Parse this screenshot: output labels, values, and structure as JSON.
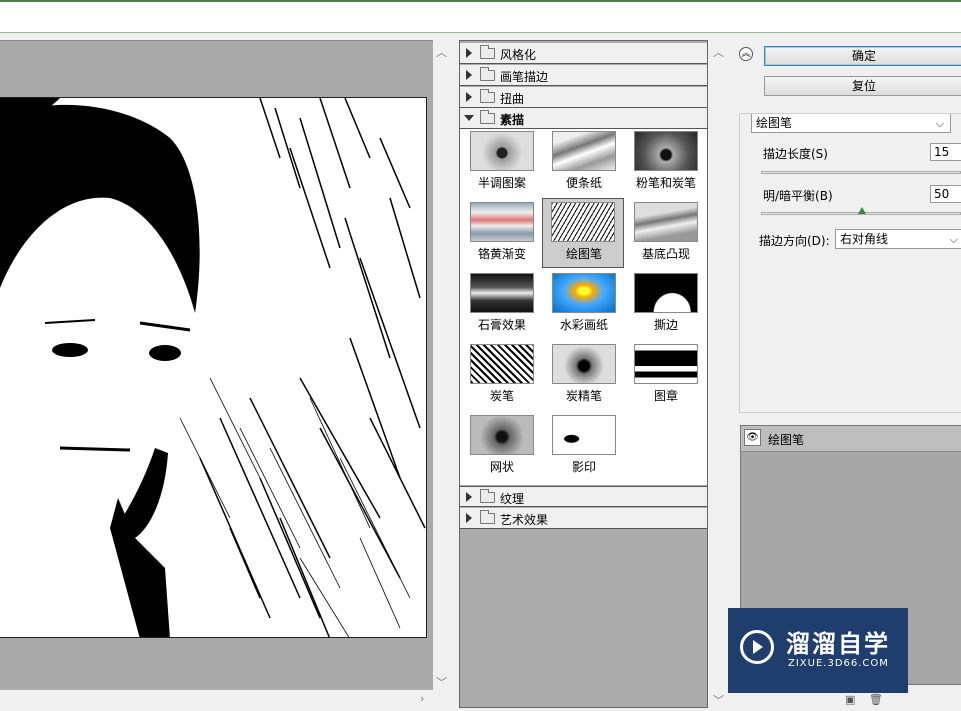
{
  "filter_categories_top": [
    {
      "label": "风格化",
      "expanded": false
    },
    {
      "label": "画笔描边",
      "expanded": false
    },
    {
      "label": "扭曲",
      "expanded": false
    },
    {
      "label": "素描",
      "expanded": true
    }
  ],
  "sketch_filters": [
    {
      "label": "半调图案",
      "selected": false
    },
    {
      "label": "便条纸",
      "selected": false
    },
    {
      "label": "粉笔和炭笔",
      "selected": false
    },
    {
      "label": "铬黄渐变",
      "selected": false
    },
    {
      "label": "绘图笔",
      "selected": true
    },
    {
      "label": "基底凸现",
      "selected": false
    },
    {
      "label": "石膏效果",
      "selected": false
    },
    {
      "label": "水彩画纸",
      "selected": false
    },
    {
      "label": "撕边",
      "selected": false
    },
    {
      "label": "炭笔",
      "selected": false
    },
    {
      "label": "炭精笔",
      "selected": false
    },
    {
      "label": "图章",
      "selected": false
    },
    {
      "label": "网状",
      "selected": false
    },
    {
      "label": "影印",
      "selected": false
    }
  ],
  "filter_categories_bottom": [
    {
      "label": "纹理",
      "expanded": false
    },
    {
      "label": "艺术效果",
      "expanded": false
    }
  ],
  "buttons": {
    "ok": "确定",
    "reset": "复位"
  },
  "settings": {
    "filter_select": "绘图笔",
    "stroke_length": {
      "label": "描边长度(S)",
      "value": "15"
    },
    "light_dark_balance": {
      "label": "明/暗平衡(B)",
      "value": "50",
      "fraction": 0.5
    },
    "stroke_direction": {
      "label": "描边方向(D):",
      "value": "右对角线"
    }
  },
  "layers": {
    "current": "绘图笔"
  },
  "watermark": {
    "title": "溜溜自学",
    "subtitle": "ZIXUE.3D66.COM"
  },
  "colors": {
    "preview_bg": "#a9a9a9",
    "selected_thumb": "#cccccc",
    "watermark_bg": "#1f3e6e"
  }
}
